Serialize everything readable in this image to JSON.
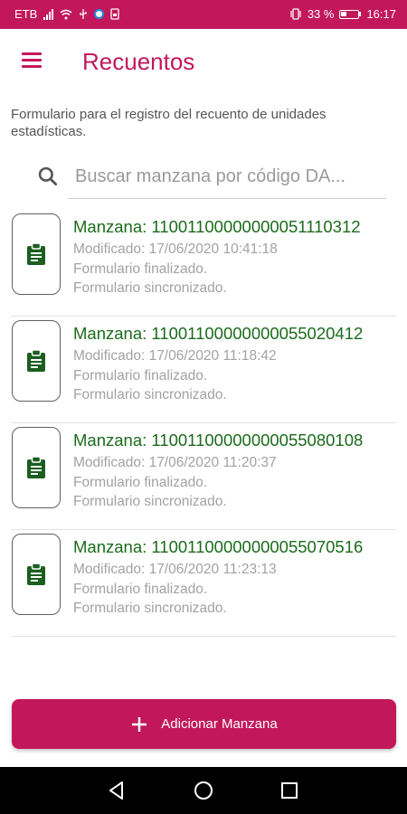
{
  "status_bar": {
    "carrier": "ETB",
    "battery": "33 %",
    "time": "16:17"
  },
  "app_bar": {
    "title": "Recuentos",
    "menu_icon": "hamburger-menu-icon"
  },
  "description": "Formulario para el registro del recuento de unidades estadísticas.",
  "search": {
    "placeholder": "Buscar manzana por código DA...",
    "value": "",
    "icon": "search-icon"
  },
  "manzanas": [
    {
      "title": "Manzana: 11001100000000051110312",
      "modified": "Modificado: 17/06/2020 10:41:18",
      "status_1": "Formulario finalizado.",
      "status_2": "Formulario sincronizado."
    },
    {
      "title": "Manzana: 11001100000000055020412",
      "modified": "Modificado: 17/06/2020 11:18:42",
      "status_1": "Formulario finalizado.",
      "status_2": "Formulario sincronizado."
    },
    {
      "title": "Manzana: 11001100000000055080108",
      "modified": "Modificado: 17/06/2020 11:20:37",
      "status_1": "Formulario finalizado.",
      "status_2": "Formulario sincronizado."
    },
    {
      "title": "Manzana: 11001100000000055070516",
      "modified": "Modificado: 17/06/2020 11:23:13",
      "status_1": "Formulario finalizado.",
      "status_2": "Formulario sincronizado."
    }
  ],
  "add_button": {
    "label": "Adicionar Manzana",
    "icon": "plus-icon"
  },
  "colors": {
    "primary": "#c2185b",
    "item_title": "#1b6b1b",
    "secondary_text": "#a2a2a2"
  }
}
